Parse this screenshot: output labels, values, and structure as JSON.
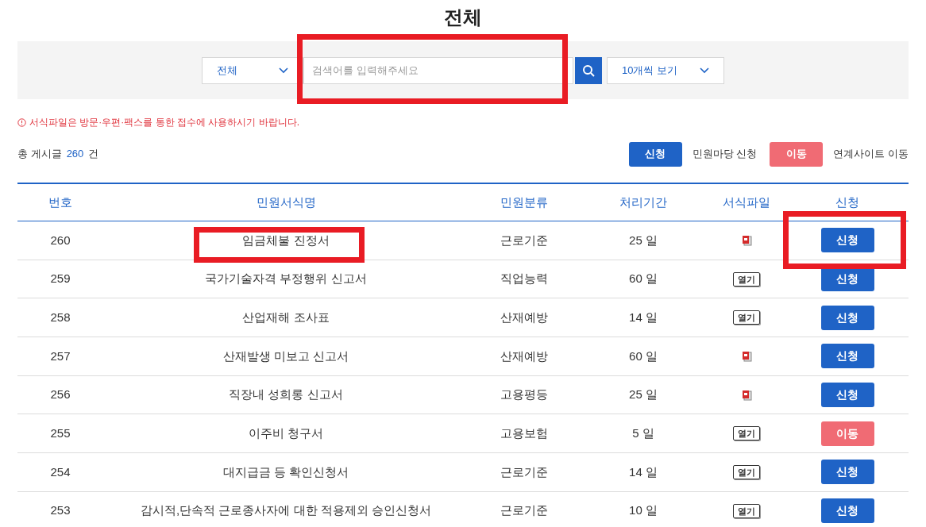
{
  "title": "전체",
  "search": {
    "category": "전체",
    "placeholder": "검색어를 입력해주세요",
    "page_size": "10개씩 보기"
  },
  "notice": "서식파일은 방문·우편·팩스를 통한 접수에 사용하시기 바랍니다.",
  "total": {
    "label": "총 게시글",
    "count": "260",
    "unit": "건"
  },
  "legend": [
    {
      "kind": "apply",
      "button": "신청",
      "text": "민원마당 신청"
    },
    {
      "kind": "move",
      "button": "이동",
      "text": "연계사이트 이동"
    }
  ],
  "table": {
    "columns": [
      "번호",
      "민원서식명",
      "민원분류",
      "처리기간",
      "서식파일",
      "신청"
    ],
    "rows": [
      {
        "no": "260",
        "name": "임금체불 진정서",
        "category": "근로기준",
        "period": "25 일",
        "file": {
          "kind": "hwp"
        },
        "action": {
          "kind": "apply",
          "label": "신청"
        }
      },
      {
        "no": "259",
        "name": "국가기술자격 부정행위 신고서",
        "category": "직업능력",
        "period": "60 일",
        "file": {
          "kind": "open",
          "label": "열기"
        },
        "action": {
          "kind": "apply",
          "label": "신청"
        }
      },
      {
        "no": "258",
        "name": "산업재해 조사표",
        "category": "산재예방",
        "period": "14 일",
        "file": {
          "kind": "open",
          "label": "열기"
        },
        "action": {
          "kind": "apply",
          "label": "신청"
        }
      },
      {
        "no": "257",
        "name": "산재발생 미보고 신고서",
        "category": "산재예방",
        "period": "60 일",
        "file": {
          "kind": "hwp"
        },
        "action": {
          "kind": "apply",
          "label": "신청"
        }
      },
      {
        "no": "256",
        "name": "직장내 성희롱 신고서",
        "category": "고용평등",
        "period": "25 일",
        "file": {
          "kind": "hwp"
        },
        "action": {
          "kind": "apply",
          "label": "신청"
        }
      },
      {
        "no": "255",
        "name": "이주비 청구서",
        "category": "고용보험",
        "period": "5 일",
        "file": {
          "kind": "open",
          "label": "열기"
        },
        "action": {
          "kind": "move",
          "label": "이동"
        }
      },
      {
        "no": "254",
        "name": "대지급금 등 확인신청서",
        "category": "근로기준",
        "period": "14 일",
        "file": {
          "kind": "open",
          "label": "열기"
        },
        "action": {
          "kind": "apply",
          "label": "신청"
        }
      },
      {
        "no": "253",
        "name": "감시적,단속적 근로종사자에 대한 적용제외 승인신청서",
        "category": "근로기준",
        "period": "10 일",
        "file": {
          "kind": "open",
          "label": "열기"
        },
        "action": {
          "kind": "apply",
          "label": "신청"
        }
      }
    ]
  }
}
